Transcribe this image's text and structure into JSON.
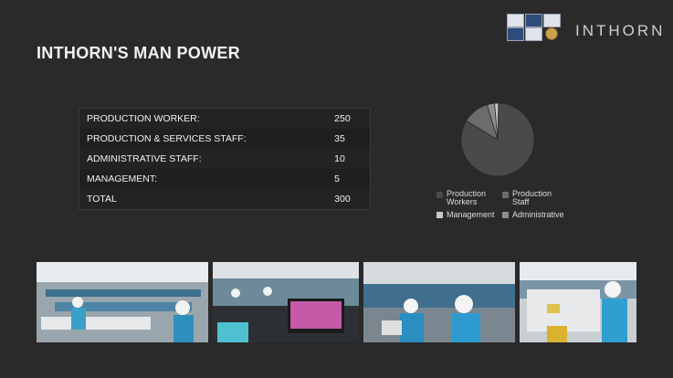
{
  "header": {
    "title": "INTHORN'S MAN POWER",
    "brand": "INTHORN"
  },
  "table": {
    "rows": [
      {
        "label": "PRODUCTION WORKER:",
        "value": "250"
      },
      {
        "label": "PRODUCTION & SERVICES STAFF:",
        "value": "35"
      },
      {
        "label": "ADMINISTRATIVE STAFF:",
        "value": "10"
      },
      {
        "label": "MANAGEMENT:",
        "value": "5"
      },
      {
        "label": "TOTAL",
        "value": "300"
      }
    ]
  },
  "chart_data": {
    "type": "pie",
    "slices": [
      {
        "name": "Production Workers",
        "value": 250,
        "color": "#4a4a4c"
      },
      {
        "name": "Production Staff",
        "value": 35,
        "color": "#6c6c6e"
      },
      {
        "name": "Management",
        "value": 5,
        "color": "#c9c9cb"
      },
      {
        "name": "Administrative",
        "value": 10,
        "color": "#8e8e90"
      }
    ],
    "legend_position": "bottom"
  },
  "legend": {
    "production_workers": "Production\nWorkers",
    "production_staff": "Production\nStaff",
    "management": "Management",
    "administrative": "Administrative"
  },
  "colors": {
    "background": "#2a2a2b"
  }
}
